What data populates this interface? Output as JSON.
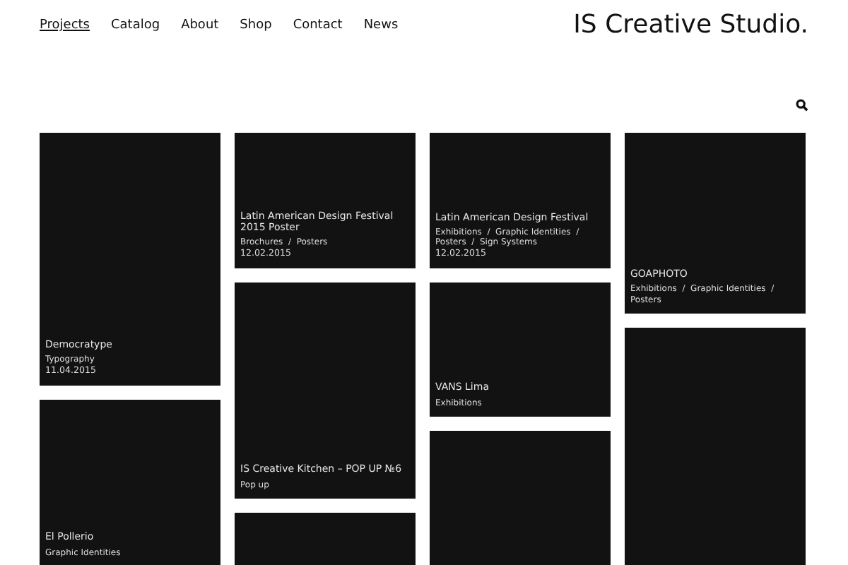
{
  "nav": [
    {
      "label": "Projects",
      "selected": true
    },
    {
      "label": "Catalog",
      "selected": false
    },
    {
      "label": "About",
      "selected": false
    },
    {
      "label": "Shop",
      "selected": false
    },
    {
      "label": "Contact",
      "selected": false
    },
    {
      "label": "News",
      "selected": false
    }
  ],
  "logo": "IS Creative Studio.",
  "columns": [
    [
      {
        "title": "Democratype",
        "tags": "Typography",
        "date": "11.04.2015"
      },
      {
        "title": "El Pollerio",
        "tags": "Graphic Identities"
      }
    ],
    [
      {
        "title": "Latin American Design Festival 2015 Poster",
        "tags": "Brochures  /  Posters",
        "date": "12.02.2015"
      },
      {
        "title": "IS Creative Kitchen – POP UP №6",
        "tags": "Pop up"
      },
      {}
    ],
    [
      {
        "title": "Latin American Design Festival",
        "tags": "Exhibitions  /  Graphic Identities  /  Posters  /  Sign Systems",
        "date": "12.02.2015"
      },
      {
        "title": "VANS Lima",
        "tags": "Exhibitions"
      },
      {}
    ],
    [
      {
        "title": "GOAPHOTO",
        "tags": "Exhibitions  /  Graphic Identities  /  Posters"
      },
      {}
    ]
  ]
}
